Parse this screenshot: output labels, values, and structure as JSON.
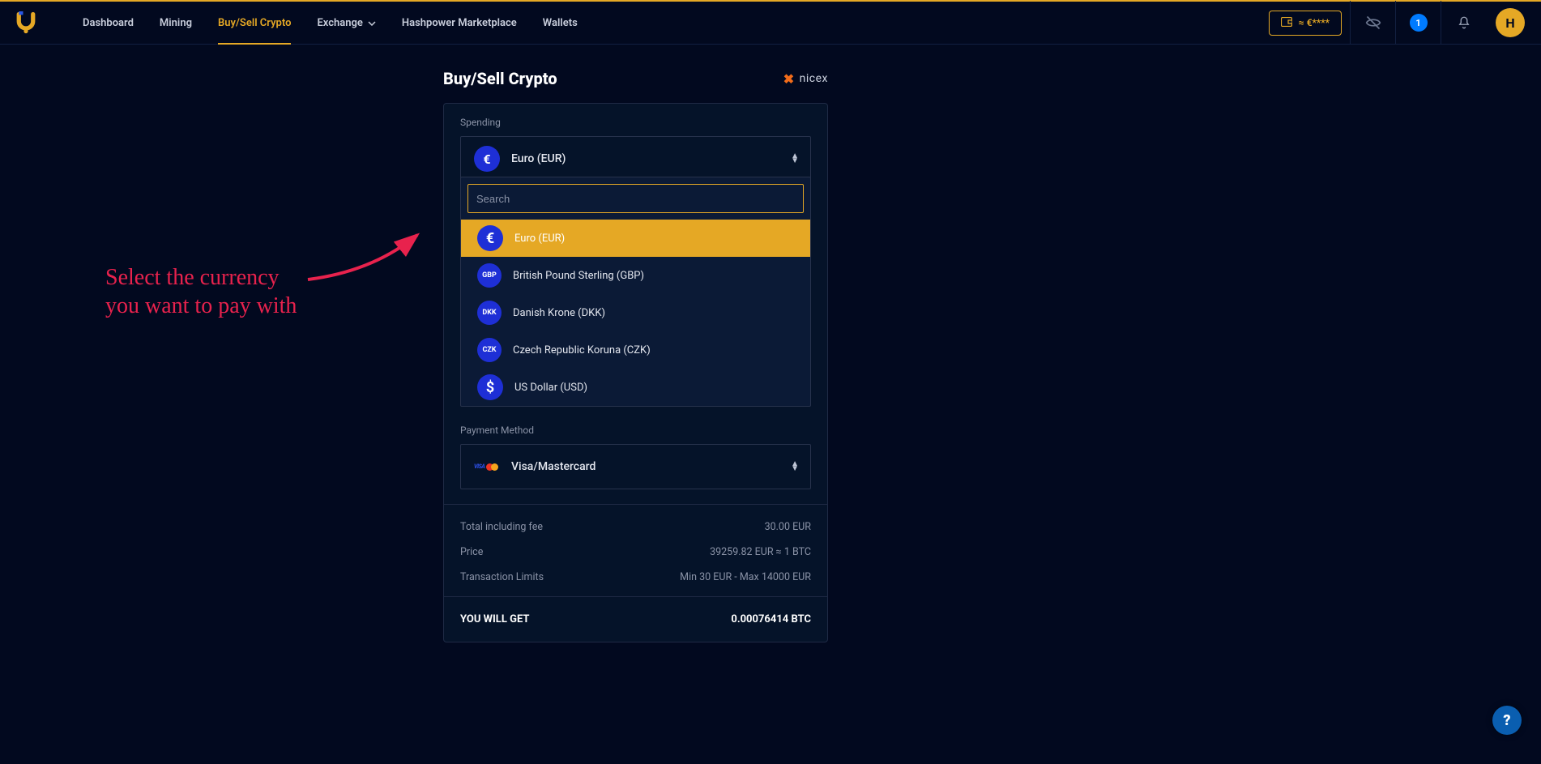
{
  "nav": {
    "items": [
      {
        "label": "Dashboard"
      },
      {
        "label": "Mining"
      },
      {
        "label": "Buy/Sell Crypto"
      },
      {
        "label": "Exchange"
      },
      {
        "label": "Hashpower Marketplace"
      },
      {
        "label": "Wallets"
      }
    ]
  },
  "topbar": {
    "balance": "≈ €****",
    "notif_count": "1",
    "avatar_initial": "H"
  },
  "page": {
    "title": "Buy/Sell Crypto",
    "brand": "nicex"
  },
  "annotation": {
    "line1": "Select the currency",
    "line2": "you want to pay with"
  },
  "spending": {
    "label": "Spending",
    "selected_symbol": "€",
    "selected_label": "Euro (EUR)"
  },
  "search": {
    "placeholder": "Search"
  },
  "currencies": [
    {
      "badge": "€",
      "label": "Euro (EUR)",
      "selected": true,
      "big": true
    },
    {
      "badge": "GBP",
      "label": "British Pound Sterling (GBP)"
    },
    {
      "badge": "DKK",
      "label": "Danish Krone (DKK)"
    },
    {
      "badge": "CZK",
      "label": "Czech Republic Koruna (CZK)"
    },
    {
      "badge": "$",
      "label": "US Dollar (USD)",
      "big": true
    }
  ],
  "payment": {
    "label": "Payment Method",
    "selected": "Visa/Mastercard"
  },
  "summary": {
    "total_label": "Total including fee",
    "total_value": "30.00 EUR",
    "price_label": "Price",
    "price_value": "39259.82 EUR ≈ 1 BTC",
    "limits_label": "Transaction Limits",
    "limits_value": "Min 30 EUR   -   Max 14000 EUR",
    "get_label": "YOU WILL GET",
    "get_value": "0.00076414 BTC"
  },
  "help": "?"
}
